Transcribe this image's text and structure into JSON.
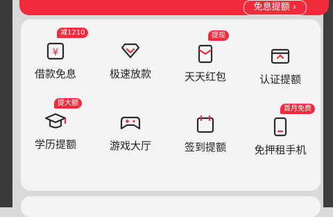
{
  "banner": {
    "button_label": "免息提额 ›"
  },
  "grid": [
    {
      "label": "借款免息",
      "badge": "减1210",
      "icon": "yen-card-icon"
    },
    {
      "label": "极速放款",
      "badge": "",
      "icon": "diamond-icon"
    },
    {
      "label": "天天红包",
      "badge": "提现",
      "icon": "red-packet-icon"
    },
    {
      "label": "认证提额",
      "badge": "",
      "icon": "wallet-icon"
    },
    {
      "label": "学历提额",
      "badge": "提大额",
      "icon": "graduation-cap-icon"
    },
    {
      "label": "游戏大厅",
      "badge": "",
      "icon": "gamepad-icon"
    },
    {
      "label": "签到提额",
      "badge": "",
      "icon": "calendar-icon"
    },
    {
      "label": "免押租手机",
      "badge": "首月免费",
      "icon": "phone-icon"
    }
  ],
  "colors": {
    "accent": "#ef2b3c",
    "icon": "#2b2b2b"
  }
}
